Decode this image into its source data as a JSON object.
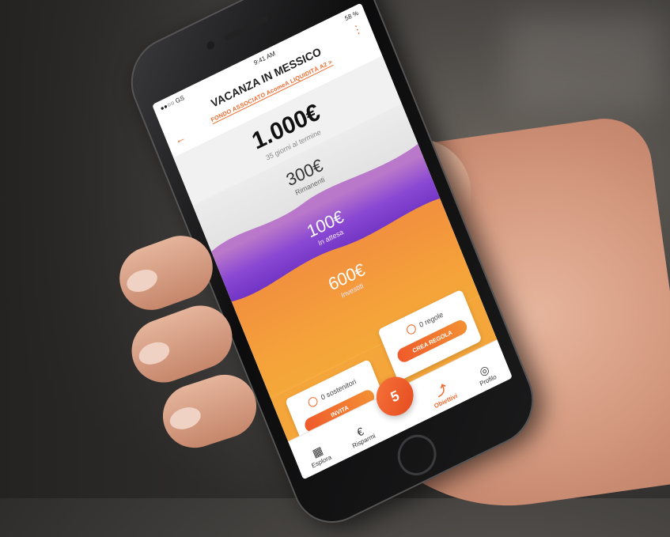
{
  "status": {
    "carrier": "●●○○ GS",
    "time": "9:41 AM",
    "battery": "58 %"
  },
  "goal": {
    "title": "VACANZA IN MESSICO",
    "fund_link": "FONDO ASSOCIATO AcomeA LIQUIDITÀ A2 >"
  },
  "target": {
    "amount": "1.000€",
    "subtitle": "35 giorni al termine"
  },
  "remaining": {
    "amount": "300€",
    "label": "Rimanenti"
  },
  "pending": {
    "amount": "100€",
    "label": "In attesa"
  },
  "invested": {
    "amount": "600€",
    "label": "Investiti"
  },
  "supporters": {
    "text": "0 sostenitori",
    "button": "INVITA"
  },
  "rules": {
    "text": "0 regole",
    "button": "CREA REGOLA"
  },
  "badge": {
    "value": "5"
  },
  "tabs": [
    {
      "label": "Esplora",
      "icon": "grid-icon"
    },
    {
      "label": "Risparmi",
      "icon": "euro-icon"
    },
    {
      "label": "Obiettivi",
      "icon": "path-icon"
    },
    {
      "label": "Profilo",
      "icon": "user-icon"
    }
  ],
  "colors": {
    "accent": "#f06a2d",
    "purple": "#8a48d3",
    "orange": "#f5a13a"
  }
}
